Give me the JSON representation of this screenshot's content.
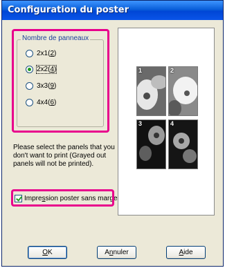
{
  "window": {
    "title": "Configuration du poster"
  },
  "panels_group": {
    "label": "Nombre de panneaux",
    "options": [
      {
        "prefix": "2x1(",
        "key": "2",
        "suffix": ")",
        "checked": false
      },
      {
        "prefix": "2x2(",
        "key": "4",
        "suffix": ")",
        "checked": true
      },
      {
        "prefix": "3x3(",
        "key": "9",
        "suffix": ")",
        "checked": false
      },
      {
        "prefix": "4x4(",
        "key": "6",
        "suffix": ")",
        "checked": false
      }
    ]
  },
  "instructions": "Please select the panels that you don't want to print (Grayed out panels will not be printed).",
  "borderless": {
    "label_pre": "Impre",
    "label_key": "s",
    "label_post": "sion poster sans marges",
    "checked": true
  },
  "preview": {
    "panel_numbers": [
      "1",
      "2",
      "3",
      "4"
    ]
  },
  "buttons": {
    "ok": {
      "key": "O",
      "rest": "K"
    },
    "cancel": {
      "pre": "A",
      "key": "n",
      "rest": "nuler"
    },
    "help": {
      "key": "A",
      "rest": "ide"
    }
  },
  "colors": {
    "highlight": "#e8008c",
    "titlebar": "#0a54e8",
    "dialog_bg": "#ece9d8"
  }
}
